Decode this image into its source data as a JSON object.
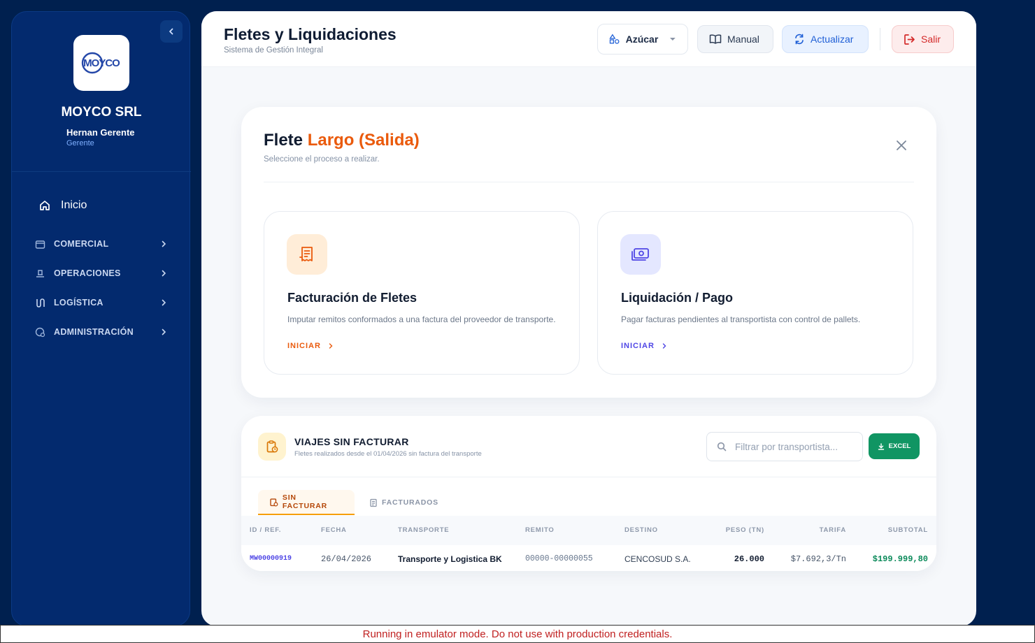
{
  "sidebar": {
    "logo_text": "MOYCO",
    "company": "MOYCO SRL",
    "user_name": "Hernan Gerente",
    "user_role": "Gerente",
    "home_label": "Inicio",
    "items": [
      {
        "label": "COMERCIAL",
        "icon": "store-icon"
      },
      {
        "label": "OPERACIONES",
        "icon": "operations-icon"
      },
      {
        "label": "LOGÍSTICA",
        "icon": "route-icon"
      },
      {
        "label": "ADMINISTRACIÓN",
        "icon": "admin-icon"
      }
    ]
  },
  "header": {
    "title": "Fletes y Liquidaciones",
    "subtitle": "Sistema de Gestión Integral",
    "product_selector": "Azúcar",
    "manual_label": "Manual",
    "update_label": "Actualizar",
    "exit_label": "Salir"
  },
  "flete": {
    "title_main": "Flete",
    "title_accent": "Largo (Salida)",
    "subtitle": "Seleccione el proceso a realizar.",
    "processes": [
      {
        "title": "Facturación de Fletes",
        "desc": "Imputar remitos conformados a una factura del proveedor de transporte.",
        "action": "INICIAR"
      },
      {
        "title": "Liquidación / Pago",
        "desc": "Pagar facturas pendientes al transportista con control de pallets.",
        "action": "INICIAR"
      }
    ]
  },
  "viajes": {
    "title": "VIAJES SIN FACTURAR",
    "subtitle": "Fletes realizados desde el 01/04/2026 sin factura del transporte",
    "search_placeholder": "Filtrar por transportista...",
    "excel_label": "EXCEL",
    "tabs": [
      {
        "label": "SIN FACTURAR",
        "active": true
      },
      {
        "label": "FACTURADOS",
        "active": false
      }
    ],
    "columns": [
      "ID / REF.",
      "FECHA",
      "TRANSPORTE",
      "REMITO",
      "DESTINO",
      "PESO (TN)",
      "TARIFA",
      "SUBTOTAL"
    ],
    "rows": [
      {
        "id": "MW00000919",
        "fecha": "26/04/2026",
        "transporte": "Transporte y Logistica BK",
        "remito": "00000-00000055",
        "destino": "CENCOSUD S.A.",
        "peso": "26.000",
        "tarifa": "$7.692,3/Tn",
        "subtotal": "$199.999,80"
      }
    ]
  },
  "footer": {
    "emulator_notice": "Running in emulator mode. Do not use with production credentials."
  },
  "colors": {
    "sidebar_bg": "#032a6e",
    "accent_orange": "#ea5a0c",
    "accent_indigo": "#4f46e5",
    "excel_green": "#109563",
    "exit_red": "#d42a2a"
  }
}
